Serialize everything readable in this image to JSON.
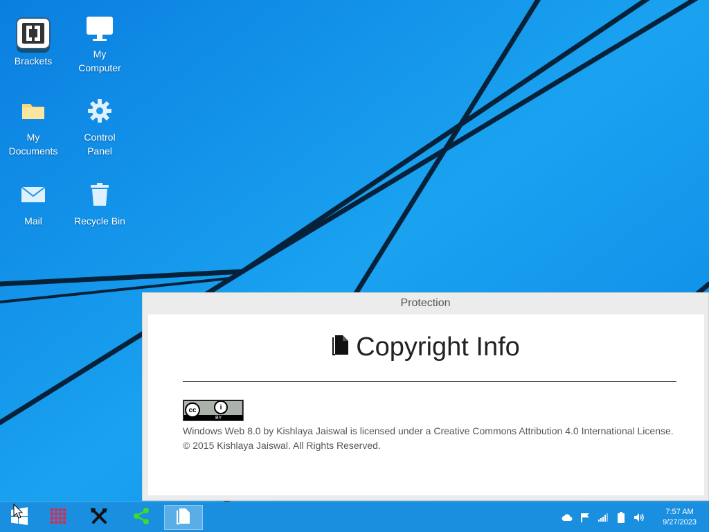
{
  "desktop": {
    "icons": [
      {
        "label": "Brackets",
        "icon": "brackets-icon"
      },
      {
        "label": "My Computer",
        "icon": "monitor-icon"
      },
      {
        "label": "My Documents",
        "icon": "folder-icon"
      },
      {
        "label": "Control Panel",
        "icon": "gear-icon"
      },
      {
        "label": "Mail",
        "icon": "mail-icon"
      },
      {
        "label": "Recycle Bin",
        "icon": "trash-icon"
      }
    ]
  },
  "window": {
    "title": "Protection",
    "heading": "Copyright Info",
    "heading_icon": "document-icon",
    "badge": {
      "cc": "cc",
      "info": "i",
      "by": "BY"
    },
    "license_line": "Windows Web 8.0 by Kishlaya Jaiswal is licensed under a Creative Commons Attribution 4.0 International License.",
    "copyright_line": "© 2015 Kishlaya Jaiswal. All Rights Reserved."
  },
  "taskbar": {
    "buttons": [
      {
        "icon": "start-icon"
      },
      {
        "icon": "apps-grid-icon"
      },
      {
        "icon": "tools-icon"
      },
      {
        "icon": "share-icon"
      },
      {
        "icon": "document-icon",
        "active": true
      }
    ],
    "tray": [
      "cloud-icon",
      "flag-icon",
      "signal-icon",
      "battery-icon",
      "volume-icon"
    ],
    "time": "7:57 AM",
    "date": "9/27/2023"
  },
  "colors": {
    "wallpaper": "#0a8ee8",
    "taskbar": "#1a8fe0",
    "share_green": "#3cdc28",
    "apps_red": "#e0284a"
  }
}
